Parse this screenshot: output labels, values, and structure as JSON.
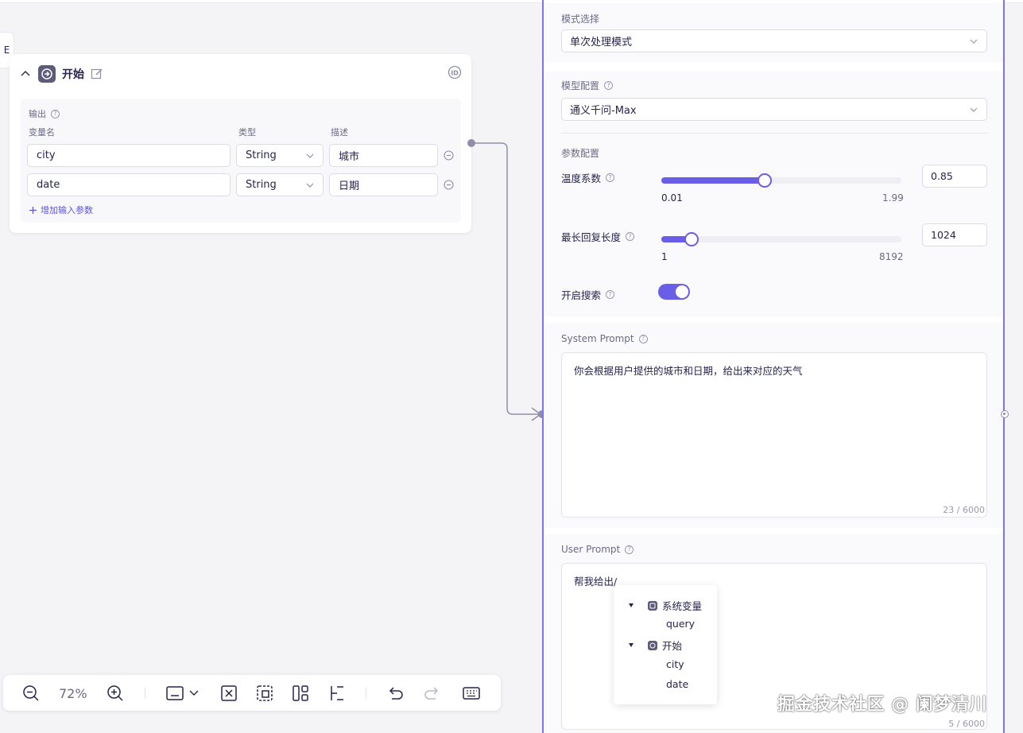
{
  "left_tab": {
    "label": "E"
  },
  "start_node": {
    "title": "开始",
    "output_label": "输出",
    "columns": {
      "name": "变量名",
      "type": "类型",
      "desc": "描述"
    },
    "rows": [
      {
        "name": "city",
        "type": "String",
        "desc": "城市"
      },
      {
        "name": "date",
        "type": "String",
        "desc": "日期"
      }
    ],
    "add_param_label": "增加输入参数"
  },
  "panel": {
    "mode_label": "模式选择",
    "mode_value": "单次处理模式",
    "model_label": "模型配置",
    "model_value": "通义千问-Max",
    "params_label": "参数配置",
    "temperature": {
      "label": "温度系数",
      "value": "0.85",
      "min": "0.01",
      "max": "1.99",
      "fraction": 0.43
    },
    "max_tokens": {
      "label": "最长回复长度",
      "value": "1024",
      "min": "1",
      "max": "8192",
      "fraction": 0.125
    },
    "search": {
      "label": "开启搜索",
      "enabled": true
    },
    "system_prompt": {
      "label": "System Prompt",
      "text": "你会根据用户提供的城市和日期，给出来对应的天气",
      "counter": "23 / 6000"
    },
    "user_prompt": {
      "label": "User Prompt",
      "text": "帮我给出/",
      "counter": "5 / 6000"
    }
  },
  "variable_dropdown": {
    "groups": [
      {
        "title": "系统变量",
        "items": [
          "query"
        ]
      },
      {
        "title": "开始",
        "items": [
          "city",
          "date"
        ]
      }
    ]
  },
  "toolbar": {
    "zoom": "72%"
  },
  "watermark": "掘金技术社区 @ 阑梦清川",
  "colors": {
    "accent": "#6b5ee6",
    "panel_border": "#7b74ee",
    "node_badge": "#5c5b7a"
  }
}
